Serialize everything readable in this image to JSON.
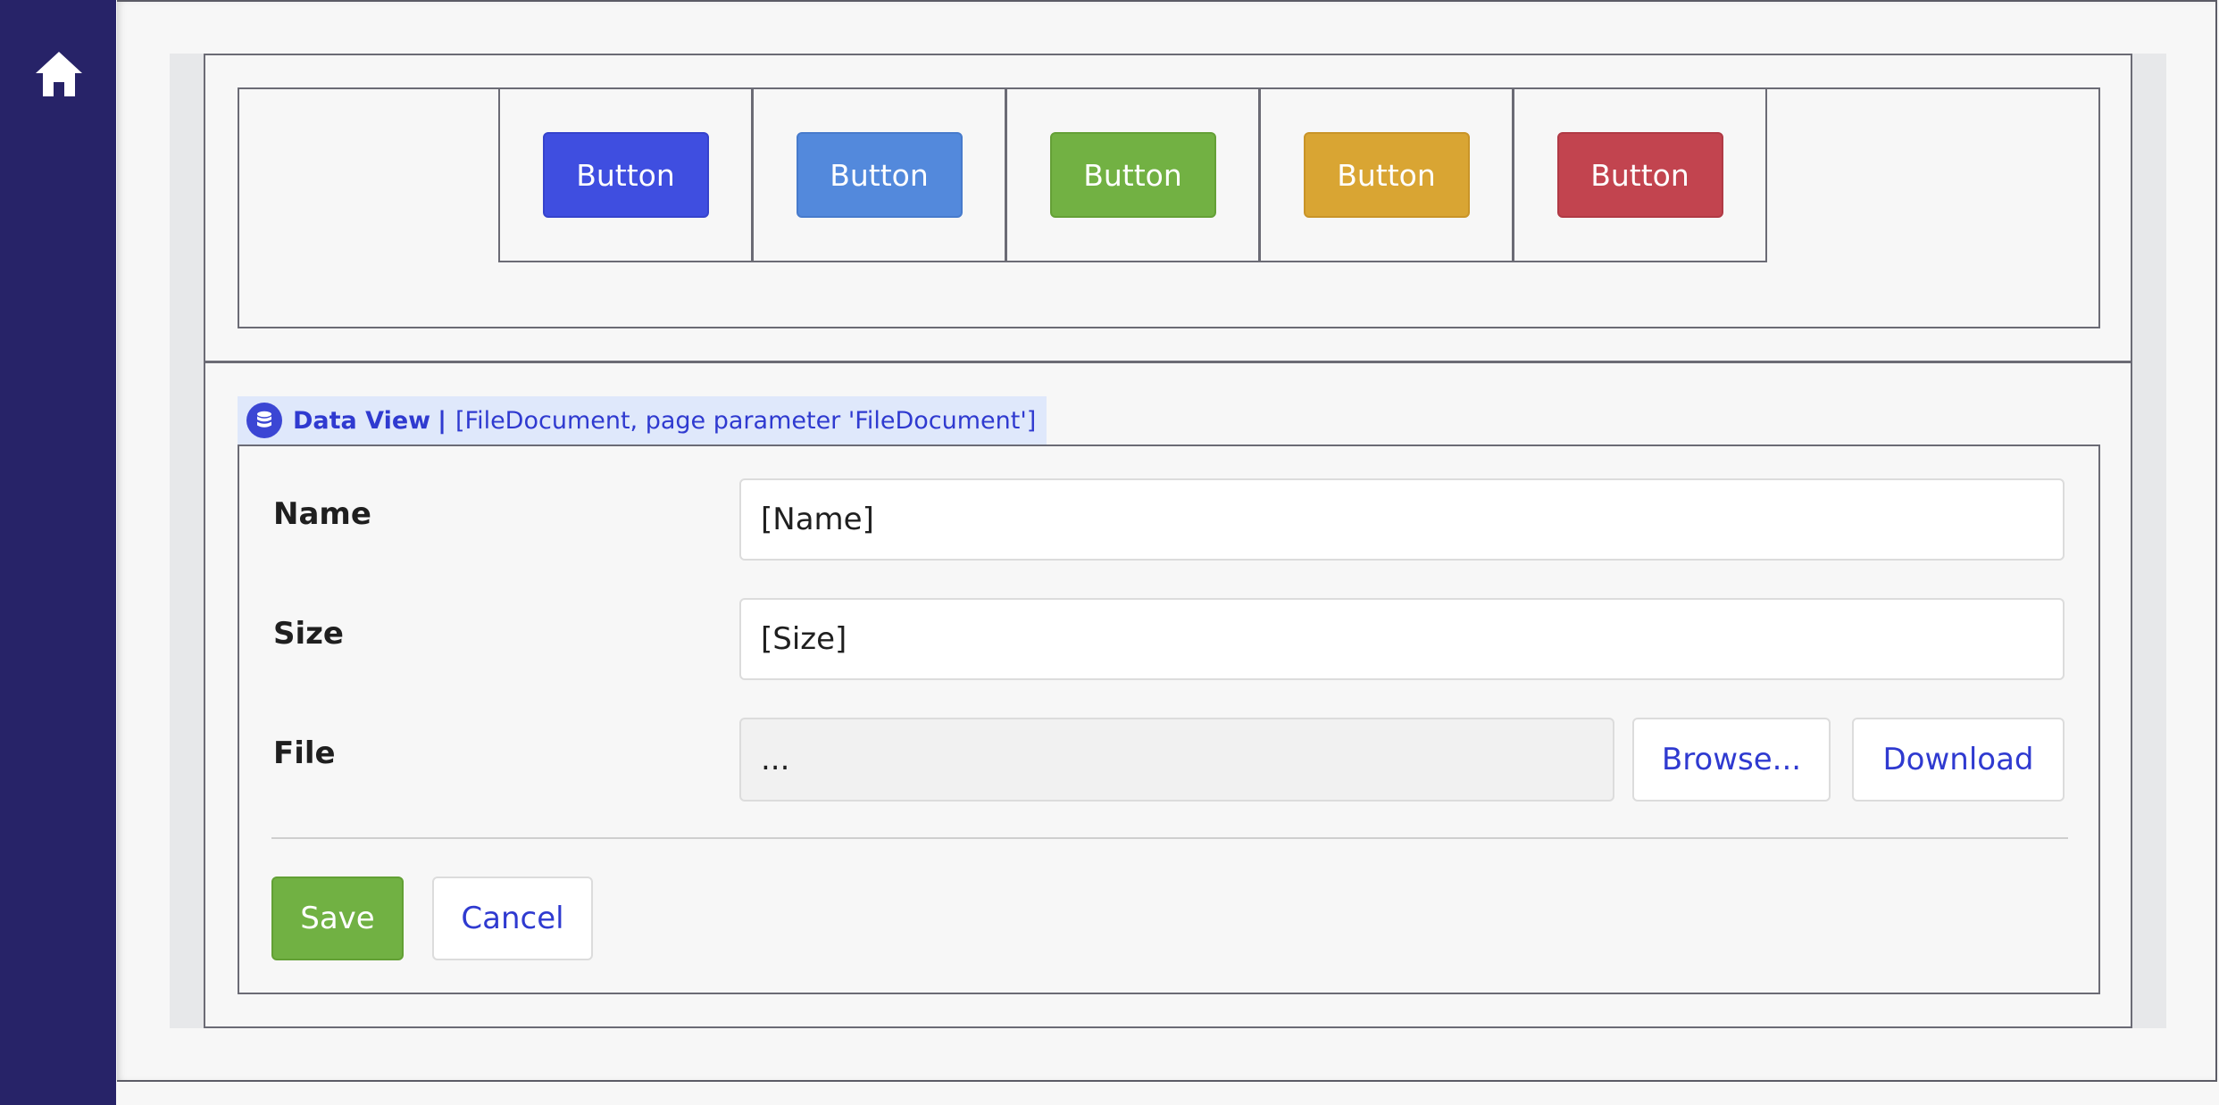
{
  "sidebar": {
    "home_icon": "home-icon"
  },
  "buttons": [
    {
      "label": "Button",
      "color": "#3f4ee0"
    },
    {
      "label": "Button",
      "color": "#5389dc"
    },
    {
      "label": "Button",
      "color": "#72b143"
    },
    {
      "label": "Button",
      "color": "#d9a533"
    },
    {
      "label": "Button",
      "color": "#c2444f"
    }
  ],
  "data_view": {
    "icon": "database-icon",
    "title": "Data View",
    "separator": "|",
    "source": "[FileDocument, page parameter 'FileDocument']"
  },
  "form": {
    "name_label": "Name",
    "name_value": "[Name]",
    "size_label": "Size",
    "size_value": "[Size]",
    "file_label": "File",
    "file_value": "...",
    "browse_label": "Browse...",
    "download_label": "Download"
  },
  "actions": {
    "save_label": "Save",
    "cancel_label": "Cancel",
    "save_color": "#71b143"
  }
}
